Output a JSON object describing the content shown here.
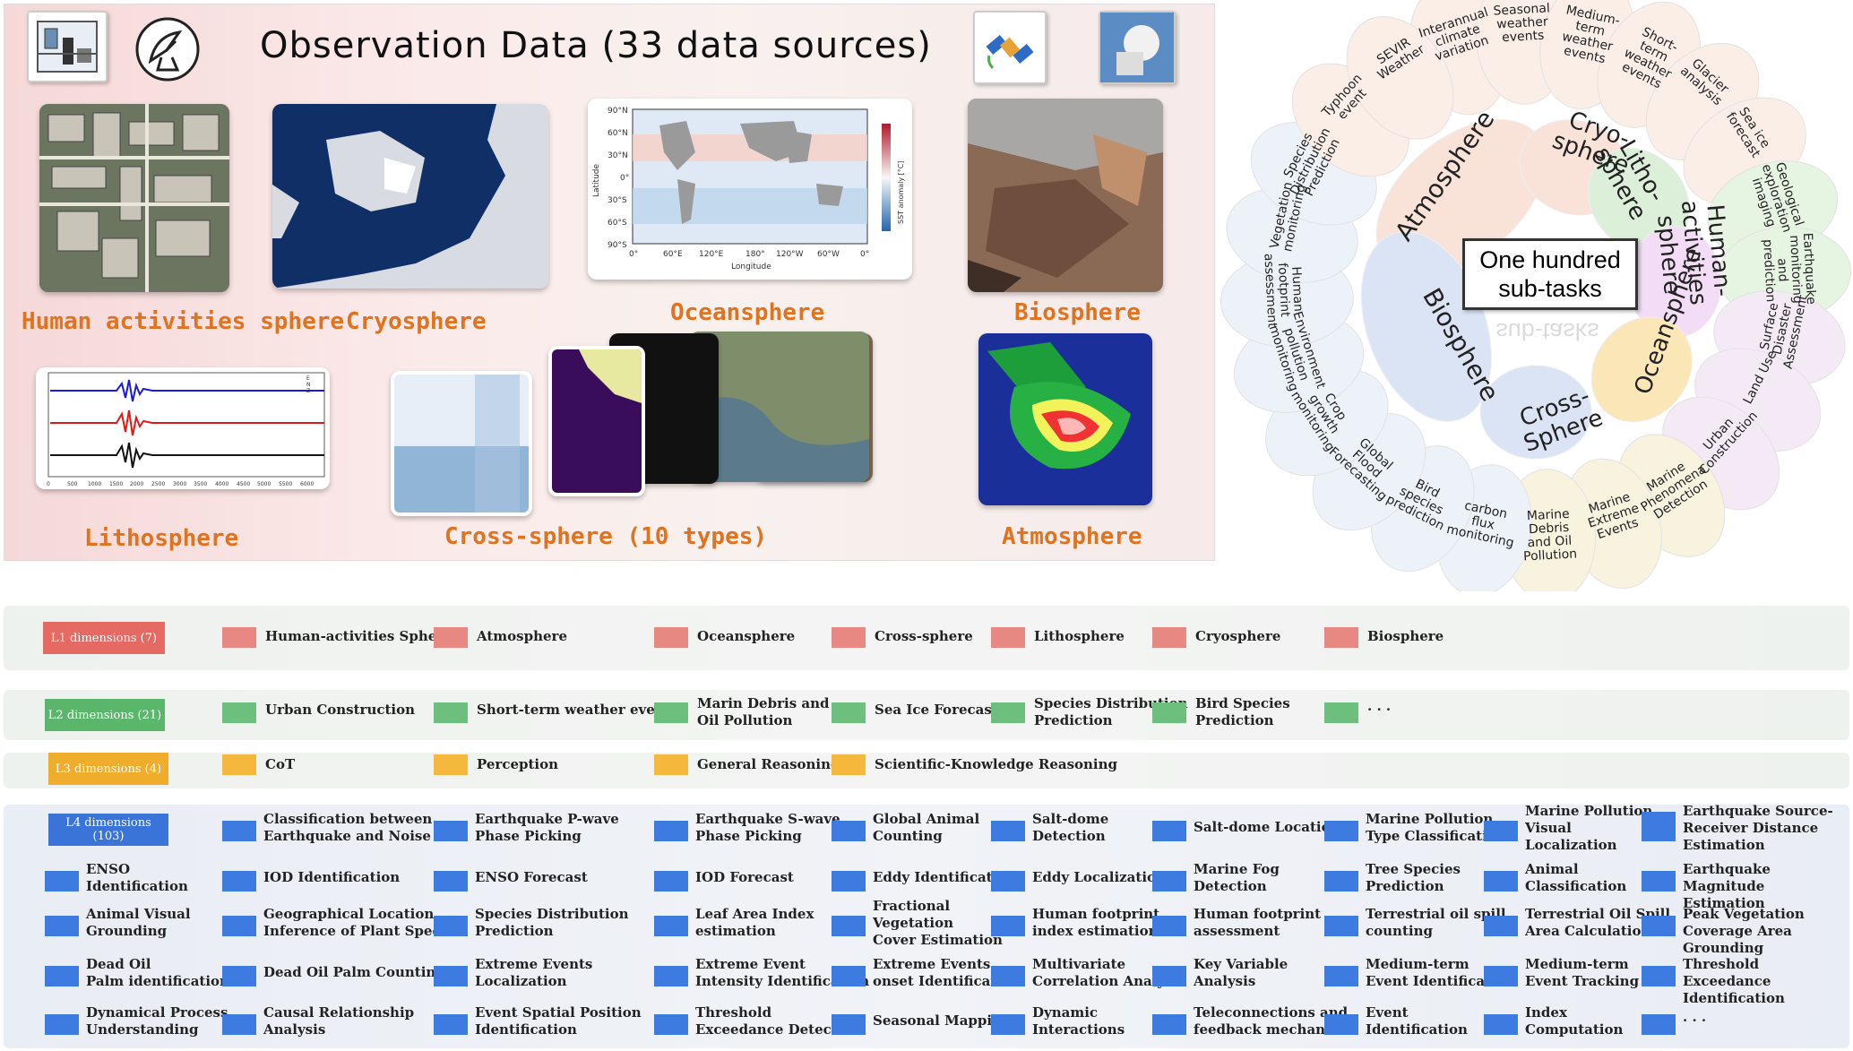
{
  "observation": {
    "title": "Observation Data  (33 data sources)",
    "spheres": {
      "human": "Human activities sphere",
      "cryo": "Cryosphere",
      "ocean": "Oceansphere",
      "bio": "Biosphere",
      "litho": "Lithosphere",
      "cross": "Cross-sphere (10 types)",
      "atmo": "Atmosphere"
    },
    "ocean_map": {
      "lat_ticks": [
        "90°N",
        "60°N",
        "30°N",
        "0°",
        "30°S",
        "60°S",
        "90°S"
      ],
      "lon_ticks": [
        "0°",
        "60°E",
        "120°E",
        "180°",
        "120°W",
        "60°W",
        "0°"
      ],
      "xlabel": "Longitude",
      "ylabel": "Latitude",
      "cbar_label": "SST anomaly [°C]"
    },
    "seismo": {
      "x_ticks": [
        "0",
        "500",
        "1000",
        "1500",
        "2000",
        "2500",
        "3000",
        "3500",
        "4000",
        "4500",
        "5000",
        "5500",
        "6000"
      ],
      "legend": [
        "E",
        "N",
        "Z"
      ]
    }
  },
  "wheel": {
    "center_title": "One hundred\nsub-tasks",
    "inner": [
      "Atmosphere",
      "Cryo-\nsphere",
      "Litho-\nsphere",
      "Human-\nactivities\nsphere",
      "Oceansphere",
      "Cross-\nSphere",
      "Biosphere"
    ],
    "outer": [
      "Interannual\nclimate\nvariation",
      "Seasonal\nweather\nevents",
      "Medium-\nterm\nweather\nevents",
      "Short-\nterm\nweather\nevents",
      "Glacier\nanalysis",
      "Sea ice\nforecast",
      "Geological\nexploration\nimaging",
      "Earthquake\nmonitoring\nand\nprediction",
      "Surface\nDisaster\nAssessment",
      "Land Use",
      "Urban\nConstruction",
      "Marine\nPhenomena\nDetection",
      "Marine\nExtreme\nEvents",
      "Marine\nDebris\nand Oil\nPollution",
      "carbon\nflux\nmonitoring",
      "Bird\nspecies\nprediction",
      "Global\nFlood\nForecasting",
      "Crop\ngrowth\nmonitoring",
      "Environment\npollution\nmonitoring",
      "Human\nfootprint\nassessment",
      "Vegetation\nmonitoring",
      "Species\nDistribution\nPrediction",
      "Typhoon\nevent",
      "SEVIR\nWeather"
    ]
  },
  "levels": {
    "l1": {
      "tag": "L1 dimensions (7)",
      "items": [
        "Human-activities Sphere",
        "Atmosphere",
        "Oceansphere",
        "Cross-sphere",
        "Lithosphere",
        "Cryosphere",
        "Biosphere"
      ]
    },
    "l2": {
      "tag": "L2 dimensions (21)",
      "items": [
        "Urban Construction",
        "Short-term weather events",
        "Marin Debris and\nOil Pollution",
        "Sea Ice Forecast",
        "Species Distribution\nPrediction",
        "Bird Species\nPrediction",
        "· · ·"
      ]
    },
    "l3": {
      "tag": "L3 dimensions (4)",
      "items": [
        "CoT",
        "Perception",
        "General Reasoning",
        "Scientific-Knowledge Reasoning"
      ]
    },
    "l4": {
      "tag": "L4 dimensions\n(103)",
      "rows": [
        [
          "",
          "Classification between\nEarthquake and Noise",
          "Earthquake P-wave\nPhase Picking",
          "Earthquake S-wave\nPhase Picking",
          "Global Animal\nCounting",
          "Salt-dome\nDetection",
          "Salt-dome Location",
          "Marine Pollution\nType Classification",
          "Marine Pollution\nVisual\nLocalization",
          "Earthquake Source-\nReceiver Distance\nEstimation"
        ],
        [
          "ENSO\nIdentification",
          "IOD Identification",
          "ENSO Forecast",
          "IOD Forecast",
          "Eddy Identification",
          "Eddy Localization",
          "Marine Fog\nDetection",
          "Tree Species\nPrediction",
          "Animal\nClassification",
          "Earthquake Magnitude\nEstimation"
        ],
        [
          "Animal Visual\nGrounding",
          "Geographical Location\nInference of Plant Species",
          "Species Distribution\nPrediction",
          "Leaf Area Index\nestimation",
          "Fractional\nVegetation\nCover Estimation",
          "Human footprint\nindex estimation",
          "Human footprint\nassessment",
          "Terrestrial oil spill\ncounting",
          "Terrestrial Oil Spill\nArea Calculation",
          "Peak Vegetation\nCoverage Area Grounding"
        ],
        [
          "Dead Oil\nPalm identification",
          "Dead Oil Palm Counting",
          "Extreme Events\nLocalization",
          "Extreme Event\nIntensity Identification",
          "Extreme Events\nonset Identification",
          "Multivariate\nCorrelation Analysis",
          "Key Variable\nAnalysis",
          "Medium-term\nEvent Identification",
          "Medium-term\nEvent Tracking",
          "Threshold\nExceedance Identification"
        ],
        [
          "Dynamical Process\nUnderstanding",
          "Causal Relationship\nAnalysis",
          "Event Spatial Position\nIdentification",
          "Threshold\nExceedance Detection",
          "Seasonal Mapping",
          "Dynamic\nInteractions",
          "Teleconnections and\nfeedback mechanism",
          "Event\nIdentification",
          "Index\nComputation",
          "· · ·"
        ]
      ]
    }
  },
  "colors": {
    "l1_tag": "#e46a63",
    "l1_sq": "#e88883",
    "l2_tag": "#5ab66b",
    "l2_sq": "#6cbf7c",
    "l3_tag": "#f0ad2c",
    "l3_sq": "#f4b93c",
    "l4_tag": "#3b74d8",
    "l4_sq": "#3d7be0",
    "sphere_label": "#e0731f"
  }
}
